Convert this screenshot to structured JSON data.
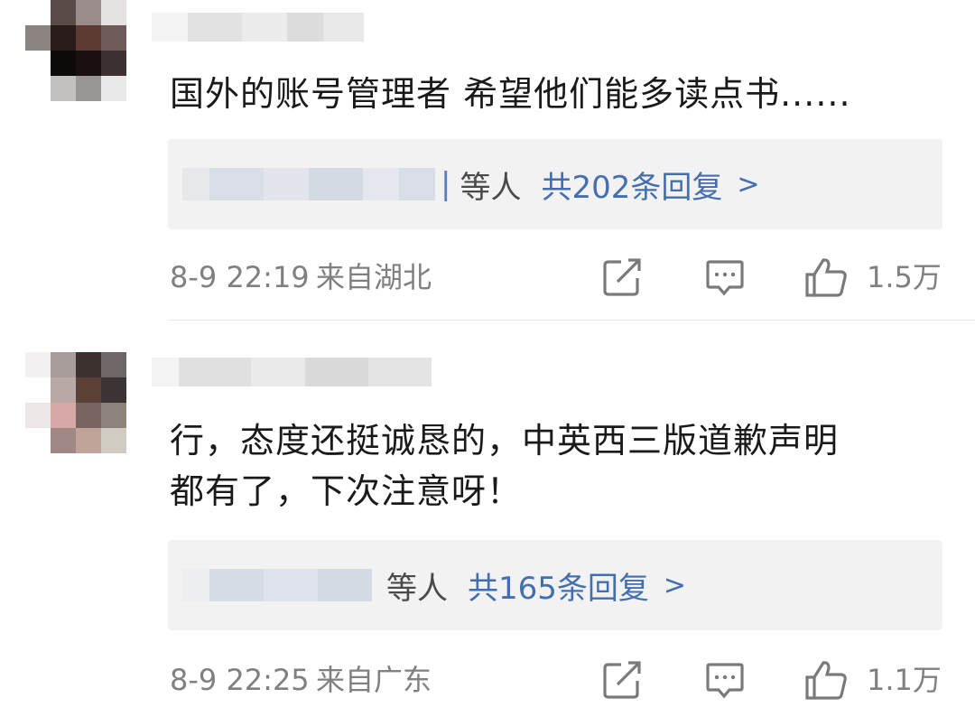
{
  "comments": [
    {
      "text": "国外的账号管理者 希望他们能多读点书......",
      "reply": {
        "sep": "|",
        "others": "等人",
        "count": "共202条回复",
        "arrow": ">"
      },
      "time": "8-9 22:19",
      "location": "来自湖北",
      "likes": "1.5万"
    },
    {
      "text": "行，态度还挺诚恳的，中英西三版道歉声明\n都有了，下次注意呀！",
      "reply": {
        "sep": "",
        "others": "等人",
        "count": "共165条回复",
        "arrow": ">"
      },
      "time": "8-9 22:25",
      "location": "来自广东",
      "likes": "1.1万"
    }
  ],
  "icons": {
    "repost": "share-edit-icon",
    "comment": "comment-bubble-icon",
    "like": "thumbs-up-icon"
  },
  "colors": {
    "link": "#436fb0",
    "text": "#1a1a1a",
    "meta": "#808080",
    "reply_bg": "#f2f2f2"
  }
}
